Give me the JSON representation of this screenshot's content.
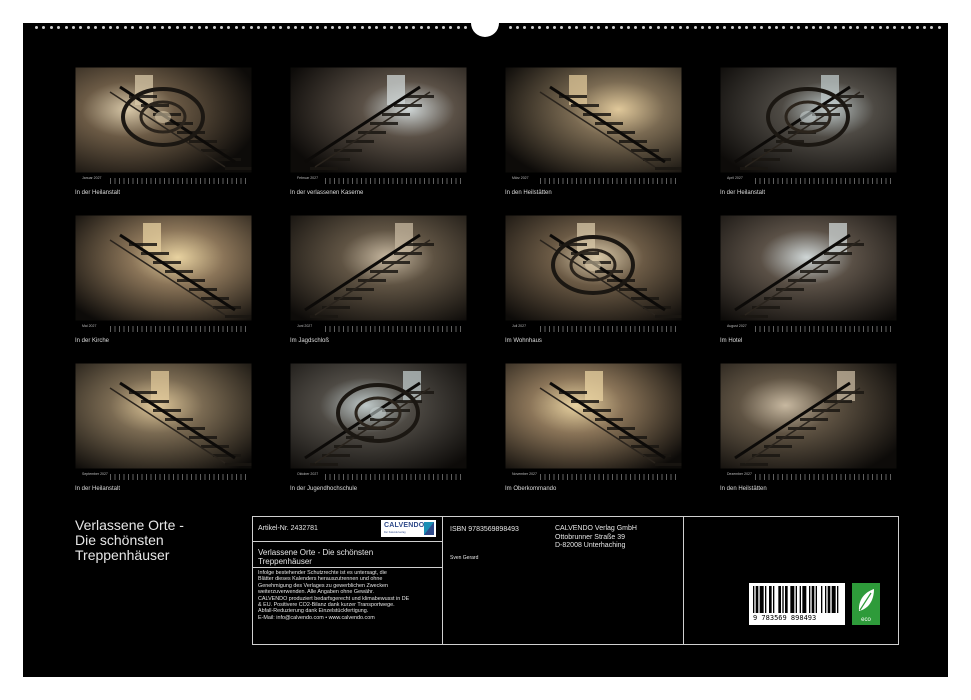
{
  "title": "Verlassene Orte -\nDie schönsten\nTreppenhäuser",
  "months": [
    {
      "name": "Januar 2027",
      "caption": "In der Heilanstalt"
    },
    {
      "name": "Februar 2027",
      "caption": "In der verlassenen Kaserne"
    },
    {
      "name": "März 2027",
      "caption": "In den Heilstätten"
    },
    {
      "name": "April 2027",
      "caption": "In der Heilanstalt"
    },
    {
      "name": "Mai 2027",
      "caption": "In der Kirche"
    },
    {
      "name": "Juni 2027",
      "caption": "Im Jagdschloß"
    },
    {
      "name": "Juli 2027",
      "caption": "Im Wohnhaus"
    },
    {
      "name": "August 2027",
      "caption": "Im Hotel"
    },
    {
      "name": "September 2027",
      "caption": "In der Heilanstalt"
    },
    {
      "name": "Oktober 2027",
      "caption": "In der Jugendhochschule"
    },
    {
      "name": "November 2027",
      "caption": "Im Oberkommando"
    },
    {
      "name": "Dezember 2027",
      "caption": "In den Heilstätten"
    }
  ],
  "info": {
    "article": "Artikel-Nr. 2432781",
    "logo": "CALVENDO",
    "logo_sub": "Der Kalenderverlag",
    "book_title": "Verlassene Orte - Die schönsten Treppenhäuser",
    "legal_text": [
      "Infolge bestehender Schutzrechte ist es untersagt, die",
      "Blätter dieses Kalenders herauszutrennen und ohne",
      "Genehmigung des Verlages zu gewerblichen Zwecken",
      "weiterzuverwenden. Alle Angaben ohne Gewähr.",
      "CALVENDO produziert bedarfsgerecht und klimabewusst in DE",
      "& EU. Positivere CO2-Bilanz dank kurzer Transportwege.",
      "Abfall-Reduzierung dank Einzelstückfertigung.",
      "E-Mail: info@calvendo.com • www.calvendo.com"
    ],
    "isbn": "ISBN 9783569898493",
    "author": "Sven Gerard",
    "publisher": [
      "CALVENDO Verlag GmbH",
      "Ottobrunner Straße 39",
      "D-82008 Unterhaching"
    ],
    "barcode_text": "9 783569 898493",
    "eco_label": "eco"
  },
  "colors": {
    "background": "#000000",
    "text": "#e6e6e6",
    "border": "#cfcfcf",
    "eco_green": "#2e9b3a",
    "calvendo_blue": "#2f4a8a"
  }
}
